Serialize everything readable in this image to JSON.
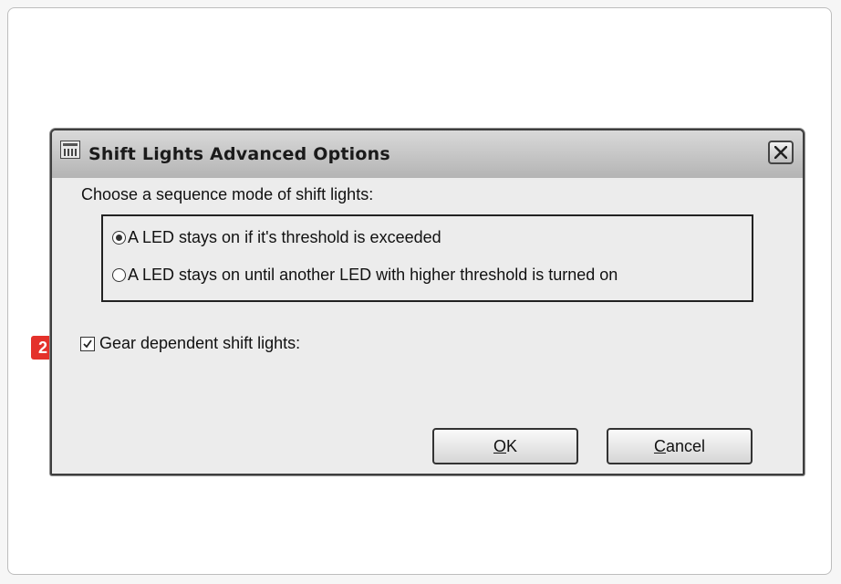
{
  "dialog": {
    "title": "Shift Lights Advanced Options",
    "heading": "Choose a sequence mode of shift lights:",
    "modes": [
      {
        "label": "A LED stays on if it's threshold is exceeded",
        "selected": true
      },
      {
        "label": "A LED stays on until another LED with higher threshold is turned on",
        "selected": false
      }
    ],
    "gear_dependent": {
      "label": "Gear dependent shift lights:",
      "checked": true
    },
    "ok": {
      "accel": "O",
      "rest": "K"
    },
    "cancel": {
      "accel": "C",
      "rest": "ancel"
    }
  },
  "annotation": {
    "marker": "2",
    "color": "#e4312b"
  },
  "icons": {
    "app": "app-icon",
    "close": "close-icon",
    "check": "check-icon"
  }
}
